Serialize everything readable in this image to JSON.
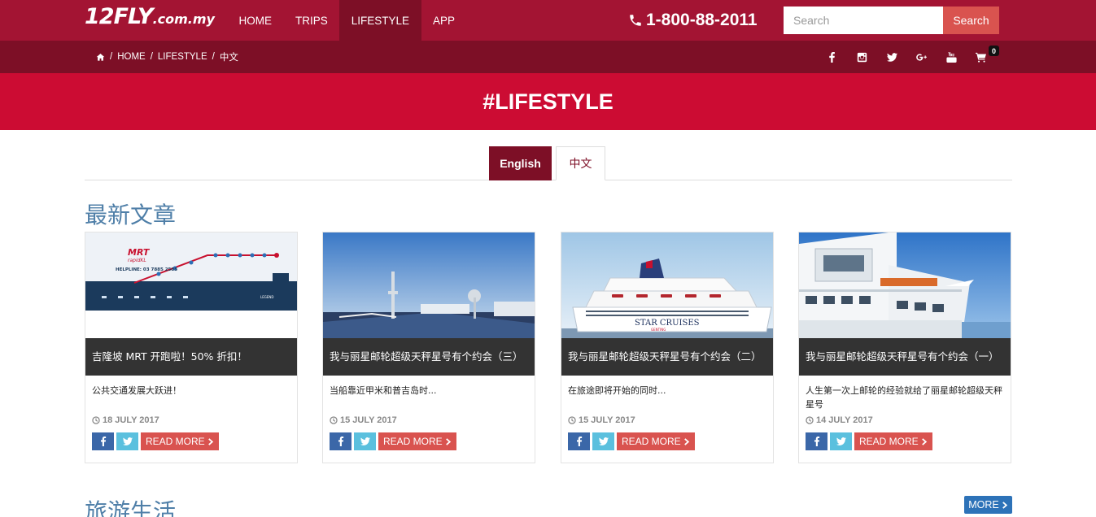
{
  "header": {
    "logo_main": "12FLY",
    "logo_suffix": ".com.my",
    "nav": [
      {
        "label": "HOME"
      },
      {
        "label": "TRIPS"
      },
      {
        "label": "LIFESTYLE"
      },
      {
        "label": "APP"
      }
    ],
    "active_nav": "LIFESTYLE",
    "phone": "1-800-88-2011",
    "search": {
      "placeholder": "Search",
      "value": "",
      "button_label": "Search"
    }
  },
  "subbar": {
    "breadcrumb": [
      "HOME",
      "LIFESTYLE",
      "中文"
    ],
    "social_icons": [
      "facebook-icon",
      "instagram-icon",
      "twitter-icon",
      "google-plus-icon",
      "youtube-icon"
    ],
    "cart_count": "0"
  },
  "hero": {
    "title": "#LIFESTYLE"
  },
  "language_tabs": [
    {
      "label": "English",
      "active": false
    },
    {
      "label": "中文",
      "active": true
    }
  ],
  "sections": {
    "latest_title": "最新文章",
    "travel_title": "旅游生活",
    "more_label": "MORE"
  },
  "articles": [
    {
      "title": "吉隆坡 MRT 开跑啦！50% 折扣！",
      "excerpt": "公共交通发展大跃进！",
      "date": "18 JULY 2017",
      "read_more": "READ MORE",
      "image": {
        "mrt_logo": "MRT",
        "brand": "rapidKL",
        "helpline": "HELPLINE: 03 7885 2585",
        "legend": "LEGEND"
      }
    },
    {
      "title": "我与丽星邮轮超级天秤星号有个约会（三）",
      "excerpt": "当船靠近甲米和普吉岛时...",
      "date": "15 JULY 2017",
      "read_more": "READ MORE",
      "image": {}
    },
    {
      "title": "我与丽星邮轮超级天秤星号有个约会（二）",
      "excerpt": "在旅途即将开始的同时...",
      "date": "15 JULY 2017",
      "read_more": "READ MORE",
      "image": {
        "hull_text": "STAR CRUISES",
        "hull_text_2": "GENTING"
      }
    },
    {
      "title": "我与丽星邮轮超级天秤星号有个约会（一）",
      "excerpt": "人生第一次上邮轮的经验就给了丽星邮轮超级天秤星号",
      "date": "14 JULY 2017",
      "read_more": "READ MORE",
      "image": {}
    }
  ],
  "colors": {
    "brand_red": "#a31433",
    "dark_red": "#7d0f26",
    "hero_red": "#cc0c33",
    "search_button": "#d9534f",
    "section_blue": "#4f7fa8",
    "facebook": "#3b67a8",
    "twitter": "#5bc0de",
    "more_blue": "#2d72b8"
  }
}
